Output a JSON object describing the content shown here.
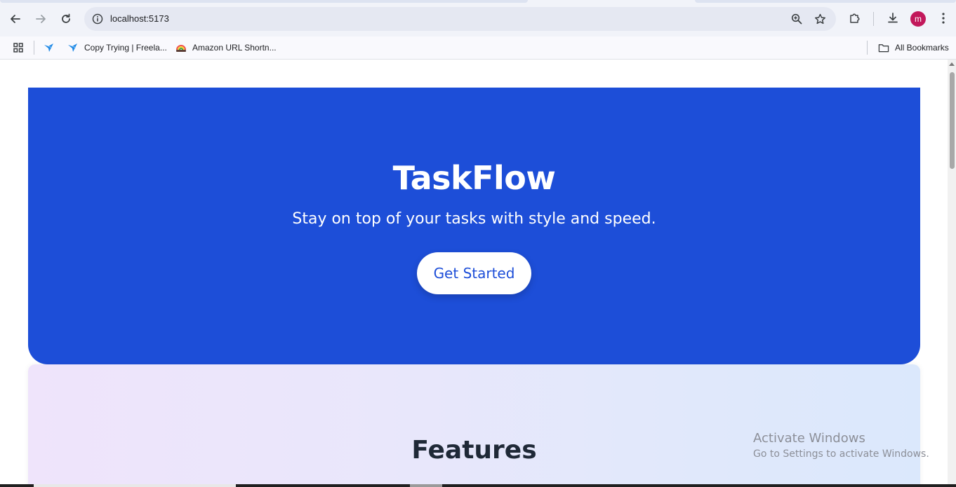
{
  "browser": {
    "url": "localhost:5173",
    "avatar_letter": "m",
    "bookmarks": [
      {
        "label": "Copy Trying | Freela...",
        "icon": "bird-icon"
      },
      {
        "label": "Amazon URL Shortn...",
        "icon": "rainbow-hat-icon"
      }
    ],
    "all_bookmarks_label": "All Bookmarks"
  },
  "hero": {
    "title": "TaskFlow",
    "subtitle": "Stay on top of your tasks with style and speed.",
    "cta_label": "Get Started",
    "background_color": "#1d4ed8"
  },
  "features": {
    "title": "Features"
  },
  "watermark": {
    "line1": "Activate Windows",
    "line2": "Go to Settings to activate Windows."
  }
}
